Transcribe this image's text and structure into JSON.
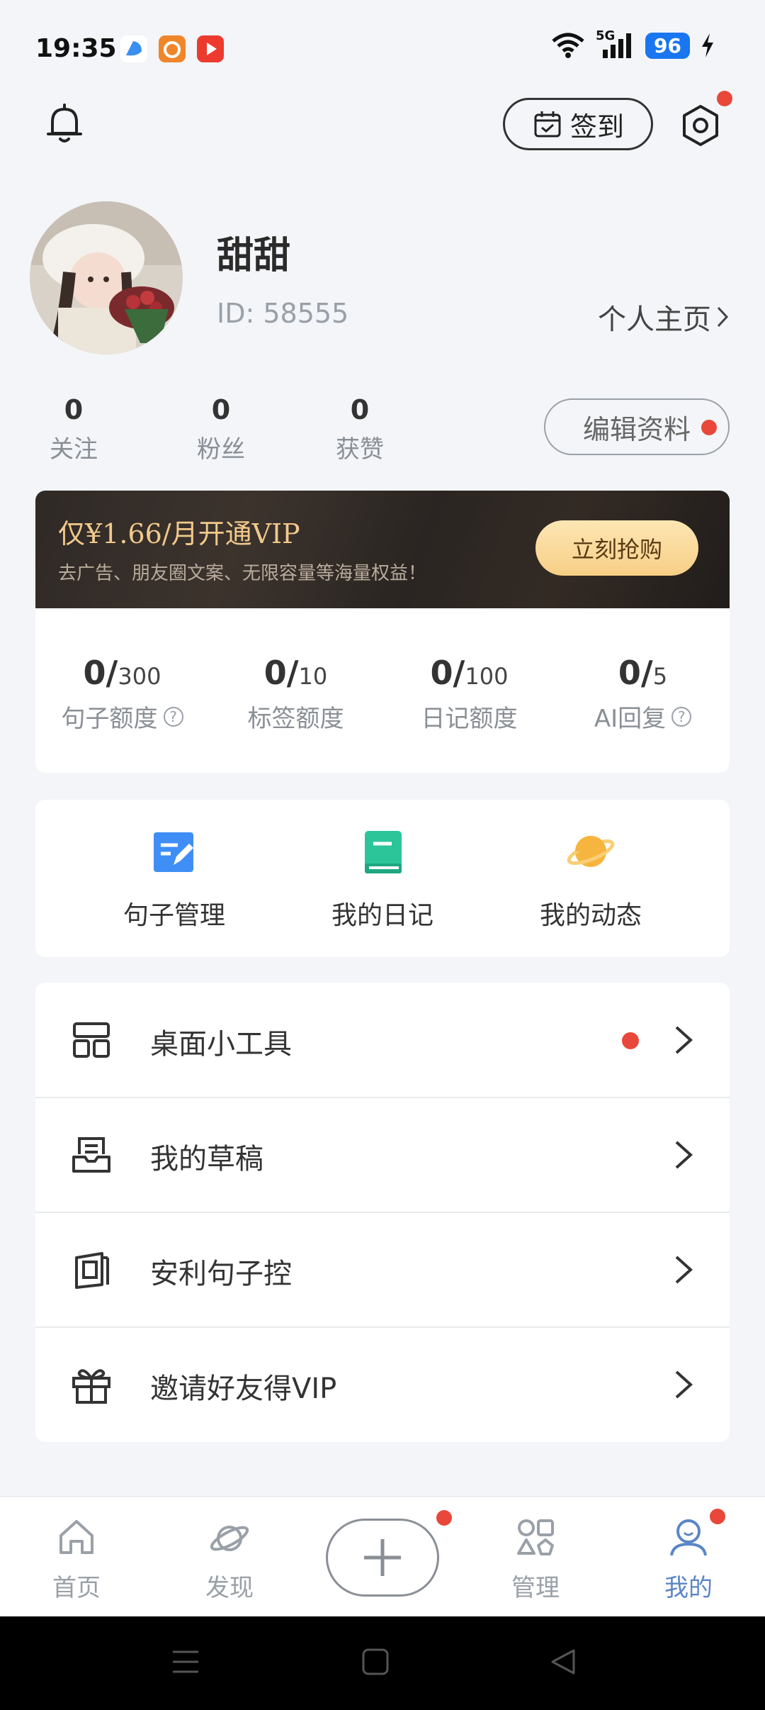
{
  "status_bar": {
    "time": "19:35",
    "network": "5G",
    "battery": "96"
  },
  "header": {
    "checkin_label": "签到"
  },
  "profile": {
    "name": "甜甜",
    "id_text": "ID: 58555",
    "homepage_label": "个人主页",
    "edit_label": "编辑资料",
    "stats": [
      {
        "value": "0",
        "label": "关注"
      },
      {
        "value": "0",
        "label": "粉丝"
      },
      {
        "value": "0",
        "label": "获赞"
      }
    ]
  },
  "vip": {
    "title": "仅¥1.66/月开通VIP",
    "subtitle": "去广告、朋友圈文案、无限容量等海量权益！",
    "buy_label": "立刻抢购"
  },
  "quotas": [
    {
      "used": "0/",
      "total": "300",
      "label": "句子额度",
      "help": true
    },
    {
      "used": "0/",
      "total": "10",
      "label": "标签额度",
      "help": false
    },
    {
      "used": "0/",
      "total": "100",
      "label": "日记额度",
      "help": false
    },
    {
      "used": "0/",
      "total": "5",
      "label": "AI回复",
      "help": true
    }
  ],
  "features": [
    {
      "label": "句子管理",
      "icon": "edit-note-icon"
    },
    {
      "label": "我的日记",
      "icon": "diary-book-icon"
    },
    {
      "label": "我的动态",
      "icon": "planet-icon"
    }
  ],
  "menu": [
    {
      "label": "桌面小工具",
      "icon": "widget-layout-icon",
      "badge": true
    },
    {
      "label": "我的草稿",
      "icon": "draft-box-icon",
      "badge": false
    },
    {
      "label": "安利句子控",
      "icon": "share-frame-icon",
      "badge": false
    },
    {
      "label": "邀请好友得VIP",
      "icon": "gift-icon",
      "badge": false
    }
  ],
  "bottom_nav": [
    {
      "label": "首页",
      "icon": "home-icon"
    },
    {
      "label": "发现",
      "icon": "planet-outline-icon"
    },
    {
      "label": "管理",
      "icon": "shapes-icon"
    },
    {
      "label": "我的",
      "icon": "person-icon"
    }
  ],
  "colors": {
    "accent": "#5b86c7",
    "badge": "#e8473a",
    "vip_gold": "#f1c98b"
  }
}
